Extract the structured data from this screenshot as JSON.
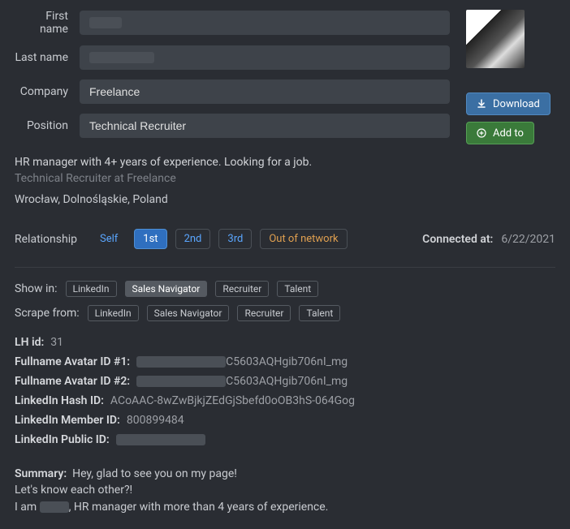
{
  "form": {
    "first_name": {
      "label": "First name",
      "value": ""
    },
    "last_name": {
      "label": "Last name",
      "value": ""
    },
    "company": {
      "label": "Company",
      "value": "Freelance"
    },
    "position": {
      "label": "Position",
      "value": "Technical Recruiter"
    }
  },
  "buttons": {
    "download": "Download",
    "add_to": "Add to"
  },
  "headline": "HR manager with 4+ years of experience. Looking for a job.",
  "subhead": "Technical Recruiter at Freelance",
  "location": "Wrocław, Dolnośląskie, Poland",
  "relationship": {
    "label": "Relationship",
    "options": [
      "Self",
      "1st",
      "2nd",
      "3rd",
      "Out of network"
    ],
    "selected": "1st",
    "connected_label": "Connected at:",
    "connected_at": "6/22/2021"
  },
  "show_in": {
    "label": "Show in:",
    "tags": [
      "LinkedIn",
      "Sales Navigator",
      "Recruiter",
      "Talent"
    ],
    "active": "Sales Navigator"
  },
  "scrape_from": {
    "label": "Scrape from:",
    "tags": [
      "LinkedIn",
      "Sales Navigator",
      "Recruiter",
      "Talent"
    ]
  },
  "ids": {
    "lh_id": {
      "k": "LH id:",
      "v": "31"
    },
    "avatar1": {
      "k": "Fullname Avatar ID #1:",
      "suffix": "C5603AQHgib706nI_mg"
    },
    "avatar2": {
      "k": "Fullname Avatar ID #2:",
      "suffix": "C5603AQHgib706nI_mg"
    },
    "hash": {
      "k": "LinkedIn Hash ID:",
      "v": "ACoAAC-8wZwBjkjZEdGjSbefd0oOB3hS-064Gog"
    },
    "member": {
      "k": "LinkedIn Member ID:",
      "v": "800899484"
    },
    "public": {
      "k": "LinkedIn Public ID:"
    }
  },
  "summary": {
    "label": "Summary:",
    "line1": "Hey, glad to see you on my page!",
    "line2": "Let's know each other?!",
    "line3_pre": "I am ",
    "line3_post": ", HR manager with more than 4 years of experience."
  }
}
